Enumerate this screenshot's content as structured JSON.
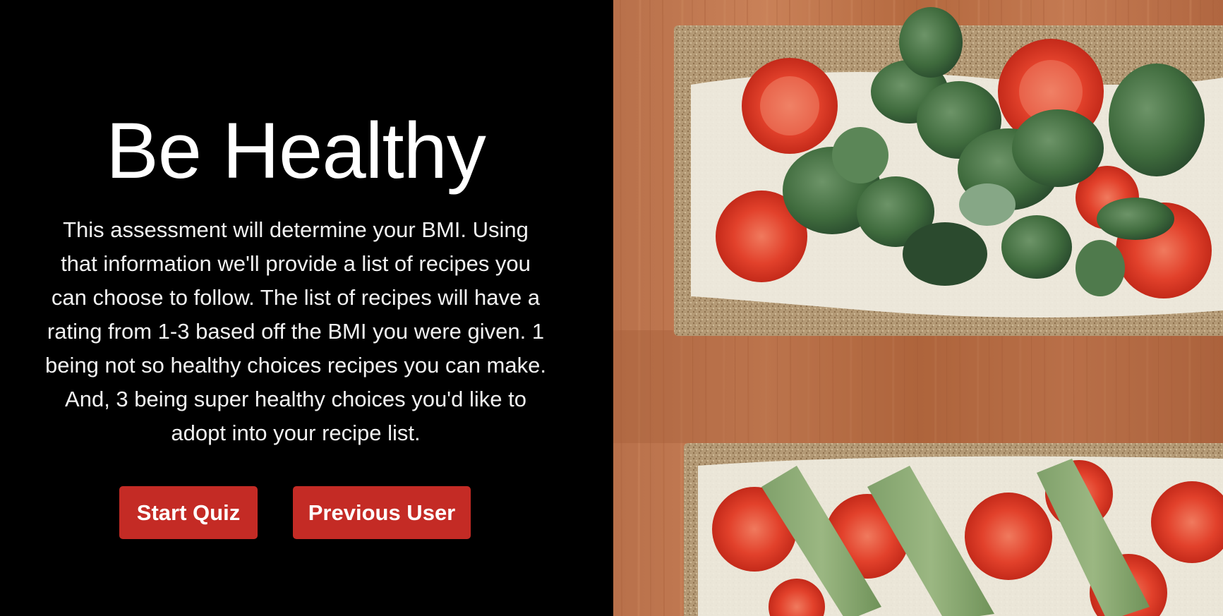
{
  "hero": {
    "title": "Be Healthy",
    "description": "This assessment will determine your BMI. Using that information we'll provide a list of recipes you can choose to follow. The list of recipes will have a rating from 1-3 based off the BMI you were given. 1 being not so healthy choices recipes you can make. And, 3 being super healthy choices you'd like to adopt into your recipe list."
  },
  "actions": {
    "start_label": "Start Quiz",
    "previous_label": "Previous User"
  },
  "colors": {
    "background": "#000000",
    "accent": "#c42b25",
    "text": "#ffffff"
  }
}
